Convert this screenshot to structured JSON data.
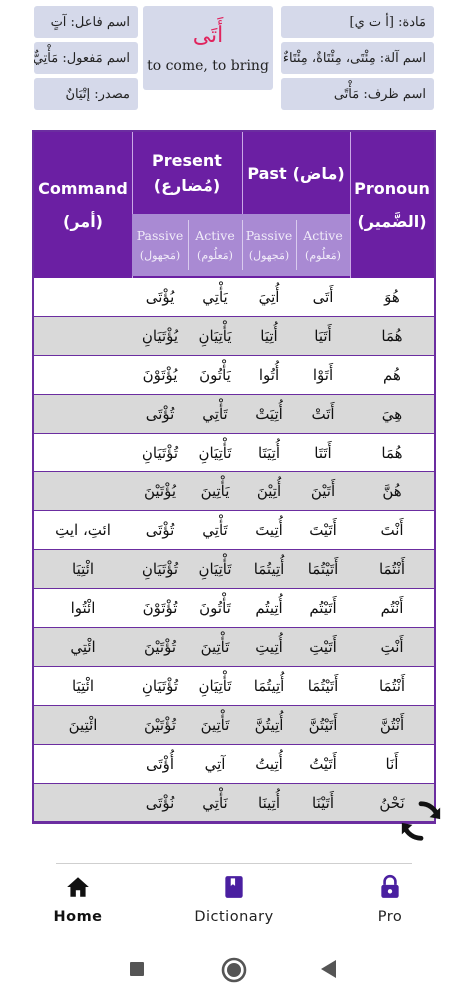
{
  "top": {
    "center_word": "أَتَى",
    "center_translation": "to come, to bring",
    "right": [
      "مَادة: [أ ت ي]",
      "اسم آلة: مِئْتَى، مِئْتَاةٌ، مِئْتَاءٌ",
      "اسم ظرف: مَأْتًى"
    ],
    "left": [
      "اسم فاعل: آتٍ",
      "اسم مَفعول: مَأْتِيٌّ",
      "مصدر: إتْيَانٌ"
    ]
  },
  "table": {
    "headers": {
      "command_en": "Command",
      "command_ar": "(أمر)",
      "present_en": "Present",
      "present_ar": "(مُضارع)",
      "past_en": "Past",
      "past_ar": "(ماض)",
      "pronoun_en": "Pronoun",
      "pronoun_ar": "(الضَّمير)",
      "passive": "Passive",
      "active": "Active",
      "passive_ar": "(مَجهول)",
      "active_ar": "(مَعلُوم)"
    },
    "rows": [
      {
        "pronoun": "هُوَ",
        "past_active": "أَتَى",
        "past_passive": "أُتِيَ",
        "present_active": "يَأْتِي",
        "present_passive": "يُؤْتَى",
        "command": ""
      },
      {
        "pronoun": "هُمَا",
        "past_active": "أَتَيَا",
        "past_passive": "أُتِيَا",
        "present_active": "يَأْتِيَانِ",
        "present_passive": "يُؤْتَيَانِ",
        "command": ""
      },
      {
        "pronoun": "هُم",
        "past_active": "أَتَوْا",
        "past_passive": "أُتُوا",
        "present_active": "يَأْتُونَ",
        "present_passive": "يُؤْتَوْنَ",
        "command": ""
      },
      {
        "pronoun": "هِيَ",
        "past_active": "أَتَتْ",
        "past_passive": "أُتِيَتْ",
        "present_active": "تَأْتِي",
        "present_passive": "تُؤْتَى",
        "command": ""
      },
      {
        "pronoun": "هُمَا",
        "past_active": "أَتَتَا",
        "past_passive": "أُتِيَتَا",
        "present_active": "تَأْتِيَانِ",
        "present_passive": "تُؤْتَيَانِ",
        "command": ""
      },
      {
        "pronoun": "هُنَّ",
        "past_active": "أَتَيْنَ",
        "past_passive": "أُتِيْنَ",
        "present_active": "يَأْتِينَ",
        "present_passive": "يُؤْتَيْنَ",
        "command": ""
      },
      {
        "pronoun": "أَنْتَ",
        "past_active": "أَتَيْتَ",
        "past_passive": "أُتِيتَ",
        "present_active": "تَأْتِي",
        "present_passive": "تُؤْتَى",
        "command": "ائتِ، ايتِ"
      },
      {
        "pronoun": "أَنْتُمَا",
        "past_active": "أَتَيْتُمَا",
        "past_passive": "أُتِيتُمَا",
        "present_active": "تَأْتِيَانِ",
        "present_passive": "تُؤْتَيَانِ",
        "command": "ائْتِيَا"
      },
      {
        "pronoun": "أَنْتُم",
        "past_active": "أَتَيْتُم",
        "past_passive": "أُتِيتُم",
        "present_active": "تَأْتُونَ",
        "present_passive": "تُؤْتَوْنَ",
        "command": "ائْتُوا"
      },
      {
        "pronoun": "أَنْتِ",
        "past_active": "أَتَيْتِ",
        "past_passive": "أُتِيتِ",
        "present_active": "تَأْتِينَ",
        "present_passive": "تُؤْتَيْنَ",
        "command": "ائْتِي"
      },
      {
        "pronoun": "أَنْتُمَا",
        "past_active": "أَتَيْتُمَا",
        "past_passive": "أُتِيتُمَا",
        "present_active": "تَأْتِيَانِ",
        "present_passive": "تُؤْتَيَانِ",
        "command": "ائْتِيَا"
      },
      {
        "pronoun": "أَنْتُنَّ",
        "past_active": "أَتَيْتُنَّ",
        "past_passive": "أُتِيتُنَّ",
        "present_active": "تَأْتِينَ",
        "present_passive": "تُؤْتَيْنَ",
        "command": "ائْتِينَ"
      },
      {
        "pronoun": "أَنَا",
        "past_active": "أَتَيْتُ",
        "past_passive": "أُتِيتُ",
        "present_active": "آتِي",
        "present_passive": "أُؤْتَى",
        "command": ""
      },
      {
        "pronoun": "نَحْنُ",
        "past_active": "أَتَيْنَا",
        "past_passive": "أُتِينَا",
        "present_active": "نَأْتِي",
        "present_passive": "نُؤْتَى",
        "command": ""
      }
    ]
  },
  "nav": {
    "items": [
      {
        "label": "Home",
        "icon": "home-icon"
      },
      {
        "label": "Dictionary",
        "icon": "book-icon"
      },
      {
        "label": "Pro",
        "icon": "lock-icon"
      }
    ]
  },
  "colors": {
    "header_purple": "#6b1fa3",
    "sub_header": "#a98ad3",
    "accent_pink": "#e0245e",
    "nav_purple": "#4a1fa0"
  }
}
